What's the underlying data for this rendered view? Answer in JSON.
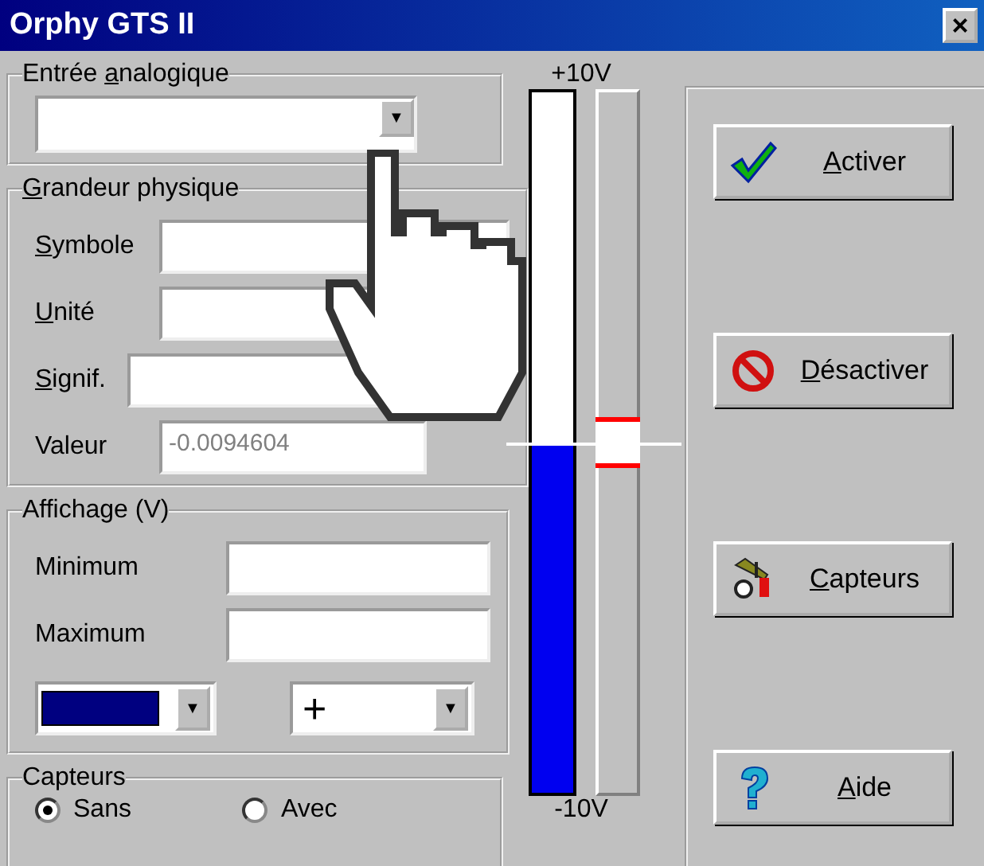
{
  "window": {
    "title": "Orphy GTS II",
    "close": "×"
  },
  "analog_input": {
    "label": {
      "before": "Entrée ",
      "key": "a",
      "after": "nalogique"
    },
    "arrow": "▼"
  },
  "physical_quantity": {
    "label": {
      "key": "G",
      "after": "randeur physique"
    },
    "fields": [
      {
        "label": {
          "key": "S",
          "after": "ymbole"
        }
      },
      {
        "label": {
          "key": "U",
          "after": "nité"
        }
      },
      {
        "label": {
          "key": "S",
          "after": "ignif."
        }
      },
      {
        "label": {
          "before": "Valeur"
        },
        "value": "-0.0094604"
      }
    ]
  },
  "display": {
    "label": {
      "before": "Affichage (V)"
    },
    "fields": [
      {
        "label": {
          "before": "Minimum"
        }
      },
      {
        "label": {
          "before": "Maximum"
        }
      }
    ],
    "color_select": {
      "color": "#000080",
      "arrow": "▼"
    },
    "marker_select": {
      "value": "+",
      "arrow": "▼"
    }
  },
  "sensors": {
    "label": {
      "before": "Capteurs"
    },
    "options": [
      {
        "label": "Sans",
        "selected": true
      },
      {
        "label": "Avec",
        "selected": false
      }
    ]
  },
  "meter": {
    "top_label": "+10V",
    "bottom_label": "-10V",
    "level": 0.495,
    "slider": {
      "level": 0.5
    }
  },
  "buttons": [
    {
      "kind": "check",
      "label": {
        "key": "A",
        "after": "ctiver"
      }
    },
    {
      "kind": "forbidden",
      "label": {
        "key": "D",
        "after": "ésactiver"
      }
    },
    {
      "kind": "tools",
      "label": {
        "key": "C",
        "after": "apteurs"
      }
    },
    {
      "kind": "help",
      "label": {
        "key": "A",
        "after": "ide"
      }
    }
  ]
}
